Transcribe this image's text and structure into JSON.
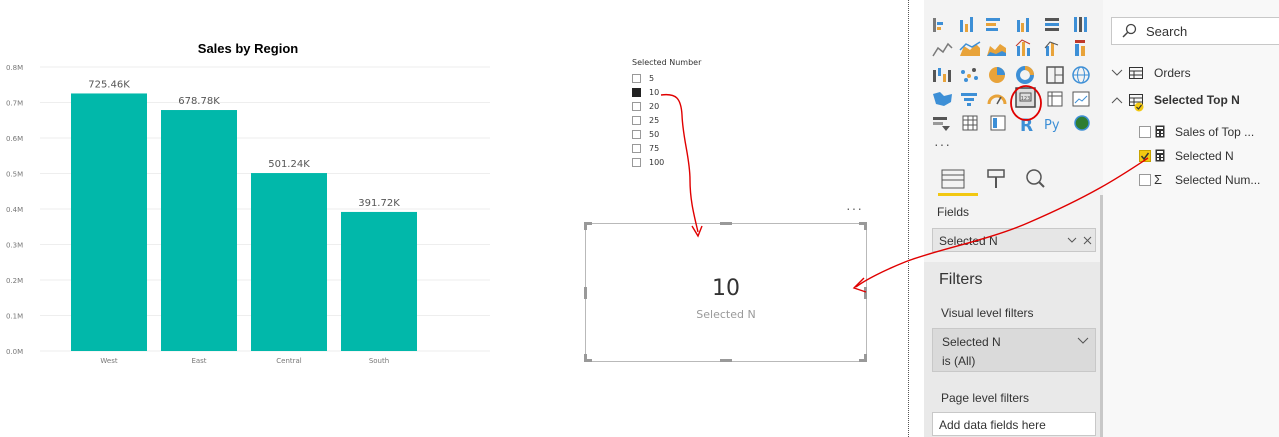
{
  "chart_data": {
    "type": "bar",
    "title": "Sales by Region",
    "categories": [
      "West",
      "East",
      "Central",
      "South"
    ],
    "values": [
      725.46,
      678.78,
      501.24,
      391.72
    ],
    "data_labels": [
      "725.46K",
      "678.78K",
      "501.24K",
      "391.72K"
    ],
    "y_ticks": [
      "0.0M",
      "0.1M",
      "0.2M",
      "0.3M",
      "0.4M",
      "0.5M",
      "0.6M",
      "0.7M",
      "0.8M"
    ],
    "ylim": [
      0,
      800
    ],
    "grid": true,
    "color": "#01b8aa"
  },
  "slicer": {
    "title": "Selected Number",
    "items": [
      {
        "label": "5",
        "checked": false
      },
      {
        "label": "10",
        "checked": true
      },
      {
        "label": "20",
        "checked": false
      },
      {
        "label": "25",
        "checked": false
      },
      {
        "label": "50",
        "checked": false
      },
      {
        "label": "75",
        "checked": false
      },
      {
        "label": "100",
        "checked": false
      }
    ]
  },
  "card": {
    "value": "10",
    "label": "Selected N",
    "more": "···"
  },
  "visualizations": {
    "more": "···",
    "fields_label": "Fields",
    "field_well": "Selected N",
    "filters_title": "Filters",
    "visual_level": "Visual level filters",
    "filter_field": "Selected N",
    "filter_state": "is (All)",
    "page_level": "Page level filters",
    "add_fields": "Add data fields here"
  },
  "fields": {
    "search_placeholder": "Search",
    "tables": [
      {
        "name": "Orders",
        "expanded": false
      },
      {
        "name": "Selected Top N",
        "expanded": true
      }
    ],
    "items": [
      {
        "name": "Sales of Top ...",
        "checked": false,
        "icon": "calculator-icon"
      },
      {
        "name": "Selected N",
        "checked": true,
        "icon": "calculator-icon"
      },
      {
        "name": "Selected Num...",
        "checked": false,
        "icon": "sigma-icon"
      }
    ]
  },
  "colors": {
    "accent": "#01b8aa",
    "annotation": "#e00000",
    "check": "#f2c811"
  }
}
